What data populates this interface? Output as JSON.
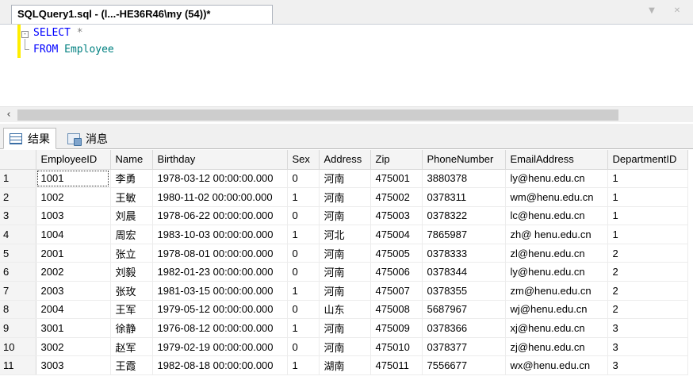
{
  "document_tab": {
    "title": "SQLQuery1.sql - (l...-HE36R46\\my (54))*"
  },
  "editor": {
    "line1": {
      "keyword": "SELECT",
      "rest": " *"
    },
    "line2": {
      "keyword": "FROM",
      "rest": " Employee"
    }
  },
  "result_tabs": [
    {
      "label": "结果",
      "icon": "results-grid-icon"
    },
    {
      "label": "消息",
      "icon": "messages-icon"
    }
  ],
  "grid": {
    "columns": [
      "EmployeeID",
      "Name",
      "Birthday",
      "Sex",
      "Address",
      "Zip",
      "PhoneNumber",
      "EmailAddress",
      "DepartmentID"
    ],
    "rows": [
      [
        "1",
        "1001",
        "李勇",
        "1978-03-12 00:00:00.000",
        "0",
        "河南",
        "475001",
        "3880378",
        "ly@henu.edu.cn",
        "1"
      ],
      [
        "2",
        "1002",
        "王敏",
        "1980-11-02 00:00:00.000",
        "1",
        "河南",
        "475002",
        "0378311",
        "wm@henu.edu.cn",
        "1"
      ],
      [
        "3",
        "1003",
        "刘晨",
        "1978-06-22 00:00:00.000",
        "0",
        "河南",
        "475003",
        "0378322",
        "lc@henu.edu.cn",
        "1"
      ],
      [
        "4",
        "1004",
        "周宏",
        "1983-10-03 00:00:00.000",
        "1",
        "河北",
        "475004",
        "7865987",
        "zh@ henu.edu.cn",
        "1"
      ],
      [
        "5",
        "2001",
        "张立",
        "1978-08-01 00:00:00.000",
        "0",
        "河南",
        "475005",
        "0378333",
        "zl@henu.edu.cn",
        "2"
      ],
      [
        "6",
        "2002",
        "刘毅",
        "1982-01-23 00:00:00.000",
        "0",
        "河南",
        "475006",
        "0378344",
        "ly@henu.edu.cn",
        "2"
      ],
      [
        "7",
        "2003",
        "张玫",
        "1981-03-15 00:00:00.000",
        "1",
        "河南",
        "475007",
        "0378355",
        "zm@henu.edu.cn",
        "2"
      ],
      [
        "8",
        "2004",
        "王军",
        "1979-05-12 00:00:00.000",
        "0",
        "山东",
        "475008",
        "5687967",
        "wj@henu.edu.cn",
        "2"
      ],
      [
        "9",
        "3001",
        "徐静",
        "1976-08-12 00:00:00.000",
        "1",
        "河南",
        "475009",
        "0378366",
        "xj@henu.edu.cn",
        "3"
      ],
      [
        "10",
        "3002",
        "赵军",
        "1979-02-19 00:00:00.000",
        "0",
        "河南",
        "475010",
        "0378377",
        "zj@henu.edu.cn",
        "3"
      ],
      [
        "11",
        "3003",
        "王霞",
        "1982-08-18 00:00:00.000",
        "1",
        "湖南",
        "475011",
        "7556677",
        "wx@henu.edu.cn",
        "3"
      ]
    ]
  }
}
